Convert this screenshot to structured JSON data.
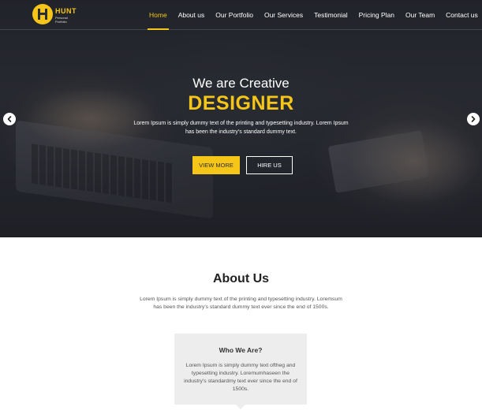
{
  "brand": {
    "name": "HUNT",
    "tagline": "Personal Portfolio"
  },
  "nav": {
    "items": [
      {
        "label": "Home",
        "active": true
      },
      {
        "label": "About us",
        "active": false
      },
      {
        "label": "Our Portfolio",
        "active": false
      },
      {
        "label": "Our Services",
        "active": false
      },
      {
        "label": "Testimonial",
        "active": false
      },
      {
        "label": "Pricing Plan",
        "active": false
      },
      {
        "label": "Our Team",
        "active": false
      },
      {
        "label": "Contact us",
        "active": false
      }
    ]
  },
  "hero": {
    "subtitle": "We are Creative",
    "title": "DESIGNER",
    "text": "Lorem Ipsum is simply dummy text of the printing and typesetting industry. Lorem Ipsum has been the industry's standard dummy text.",
    "primary_button": "VIEW MORE",
    "secondary_button": "HIRE US",
    "prev_icon": "arrow-left-icon",
    "next_icon": "arrow-right-icon"
  },
  "about": {
    "title": "About Us",
    "text": "Lorem Ipsum is simply dummy text of the printing and typesetting industry. Loremsum has been the industry's standard dummy text ever since the end of 1500s.",
    "card": {
      "title": "Who We Are?",
      "text": "Lorem Ipsum is simply dummy text oftheg and typesetting industry. Loremumhaseen the industry's standardmy text ever since the end of 1500s."
    }
  },
  "colors": {
    "accent": "#f5c518",
    "hero_bg": "#2c2f35",
    "card_bg": "#ededed"
  }
}
